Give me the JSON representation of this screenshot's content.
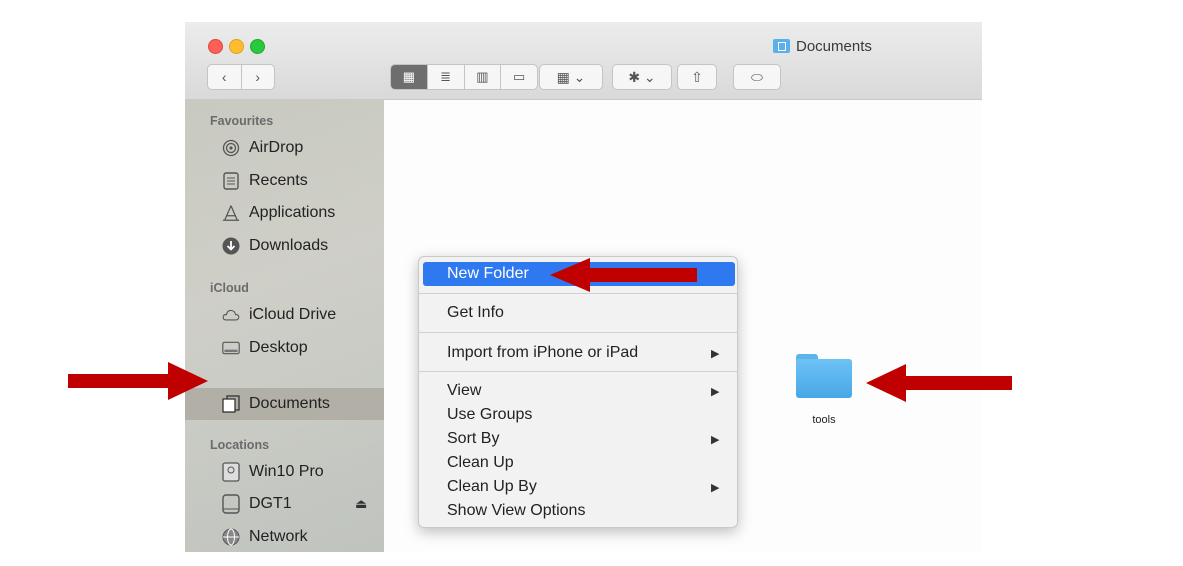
{
  "window": {
    "title": "Documents",
    "nav": {
      "back": "‹",
      "forward": "›"
    },
    "view_icons": [
      "▦",
      "≣",
      "▥",
      "▭"
    ],
    "group_icon": "▦ ⌄",
    "action_icon": "✱ ⌄",
    "share_icon": "⇧",
    "tag_icon": "⬭"
  },
  "sidebar": {
    "sections": [
      {
        "title": "Favourites",
        "items": [
          {
            "label": "AirDrop",
            "icon": "airdrop-icon"
          },
          {
            "label": "Recents",
            "icon": "recents-icon"
          },
          {
            "label": "Applications",
            "icon": "applications-icon"
          },
          {
            "label": "Downloads",
            "icon": "downloads-icon"
          }
        ]
      },
      {
        "title": "iCloud",
        "items": [
          {
            "label": "iCloud Drive",
            "icon": "cloud-icon"
          },
          {
            "label": "Desktop",
            "icon": "desktop-icon"
          },
          {
            "label": "Documents",
            "icon": "documents-icon",
            "selected": true
          }
        ]
      },
      {
        "title": "Locations",
        "items": [
          {
            "label": "Win10 Pro",
            "icon": "disk-icon"
          },
          {
            "label": "DGT1",
            "icon": "drive-icon",
            "eject": "⏏"
          },
          {
            "label": "Network",
            "icon": "network-icon"
          }
        ]
      }
    ]
  },
  "content": {
    "folder": {
      "name": "tools"
    }
  },
  "context_menu": {
    "items": [
      {
        "label": "New Folder",
        "highlighted": true
      },
      {
        "label": "Get Info"
      },
      {
        "label": "Import from iPhone or iPad",
        "submenu": "▶"
      },
      {
        "label": "View",
        "submenu": "▶"
      },
      {
        "label": "Use Groups"
      },
      {
        "label": "Sort By",
        "submenu": "▶"
      },
      {
        "label": "Clean Up"
      },
      {
        "label": "Clean Up By",
        "submenu": "▶"
      },
      {
        "label": "Show View Options"
      }
    ]
  },
  "colors": {
    "highlight": "#2e78f0",
    "annotation_arrow": "#c00000",
    "folder": "#5ab8f0"
  }
}
